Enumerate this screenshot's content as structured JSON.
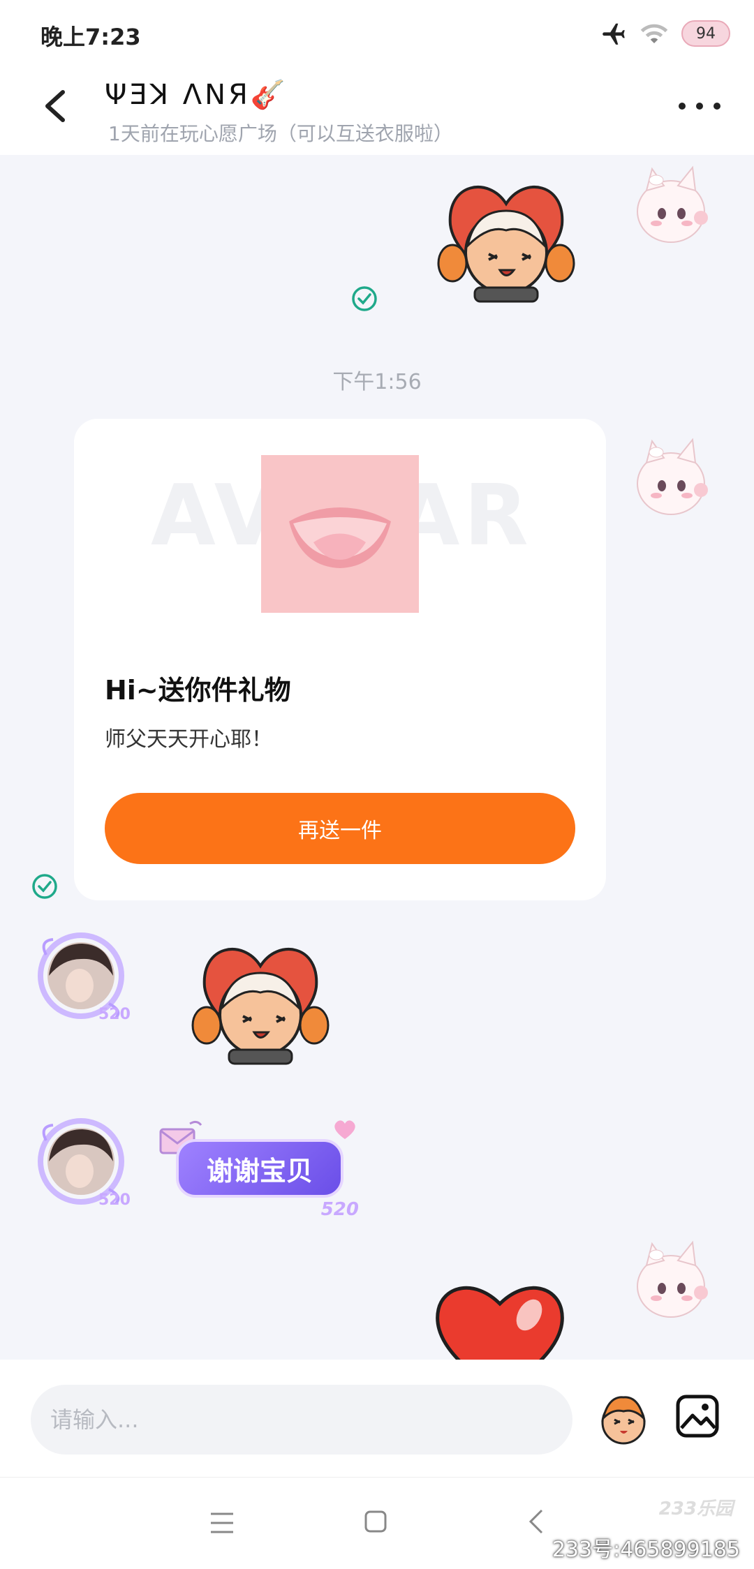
{
  "status_bar": {
    "time": "晚上7:23",
    "battery": "94",
    "icons": [
      "airplane-icon",
      "wifi-icon",
      "battery-icon"
    ]
  },
  "header": {
    "contact_name": "ΨƎꓘ ΛꓠЯ🎸",
    "contact_status": "1天前在玩心愿广场（可以互送衣服啦）"
  },
  "chat": {
    "timestamp": "下午1:56",
    "gift_card": {
      "watermark": "AVATAR",
      "title": "Hi~送你件礼物",
      "message": "师父天天开心耶！",
      "button_label": "再送一件"
    },
    "thank_bubble": {
      "text": "谢谢宝贝",
      "badge": "520"
    },
    "avatar_badge": "520"
  },
  "input_bar": {
    "placeholder": "请输入..."
  },
  "nav_bar": {
    "brand": "233乐园",
    "account_id": "233号:465899185"
  },
  "colors": {
    "accent_orange": "#fc7317",
    "check_green": "#1fa98a",
    "bubble_purple": "#7a5cf0",
    "background": "#f4f5fa"
  }
}
